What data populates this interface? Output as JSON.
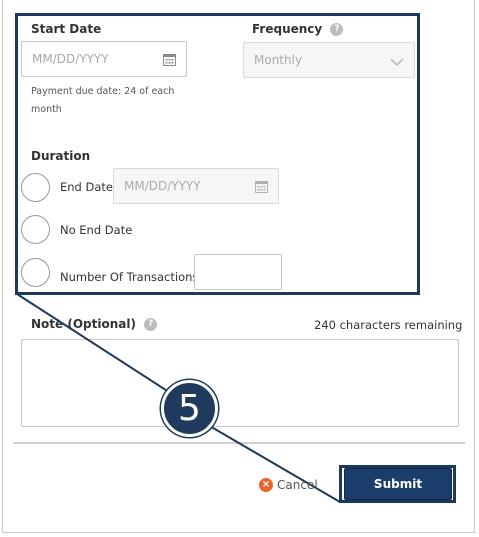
{
  "start_date": {
    "label": "Start Date",
    "placeholder": "MM/DD/YYYY",
    "hint": "Payment due date: 24 of each month"
  },
  "frequency": {
    "label": "Frequency",
    "help": "?",
    "selected": "Monthly"
  },
  "duration": {
    "label": "Duration",
    "options": [
      {
        "label": "End Date"
      },
      {
        "label": "No End Date"
      },
      {
        "label": "Number Of Transactions"
      }
    ],
    "end_date_placeholder": "MM/DD/YYYY"
  },
  "note": {
    "label": "Note (Optional)",
    "help": "?",
    "remaining": "240 characters remaining"
  },
  "actions": {
    "cancel_label": "Cancel",
    "cancel_icon": "×",
    "submit_label": "Submit"
  },
  "callout": {
    "number": "5"
  },
  "colors": {
    "accent": "#1b3d6c",
    "highlight": "#1c3a5a",
    "cancel_icon": "#e8642c"
  }
}
